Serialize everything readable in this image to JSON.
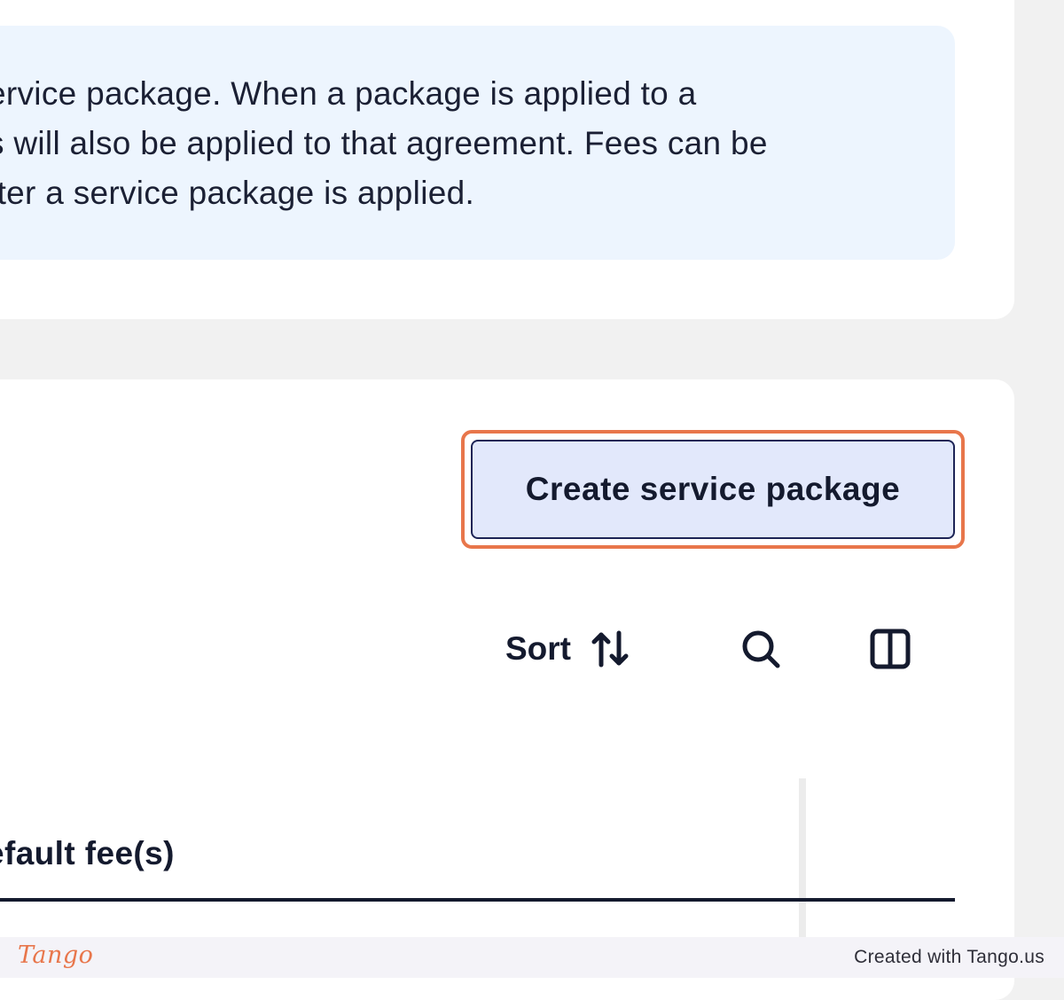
{
  "info_panel": {
    "lines": [
      "ervice package. When a package is applied to a",
      "s will also be applied to that agreement. Fees can be",
      "fter a service package is applied."
    ]
  },
  "toolbar": {
    "create_label": "Create service package",
    "sort_label": "Sort",
    "sort_icon": "sort-arrows-icon",
    "search_icon": "search-icon",
    "columns_icon": "columns-icon"
  },
  "table": {
    "headers": [
      "efault fee(s)"
    ]
  },
  "footer": {
    "logo_text": "Tango",
    "credit": "Created with Tango.us"
  },
  "colors": {
    "highlight": "#e8764b",
    "button_bg": "#e2e8fb",
    "button_border": "#1d2456",
    "info_bg": "#edf5fe",
    "text": "#141a2e"
  }
}
